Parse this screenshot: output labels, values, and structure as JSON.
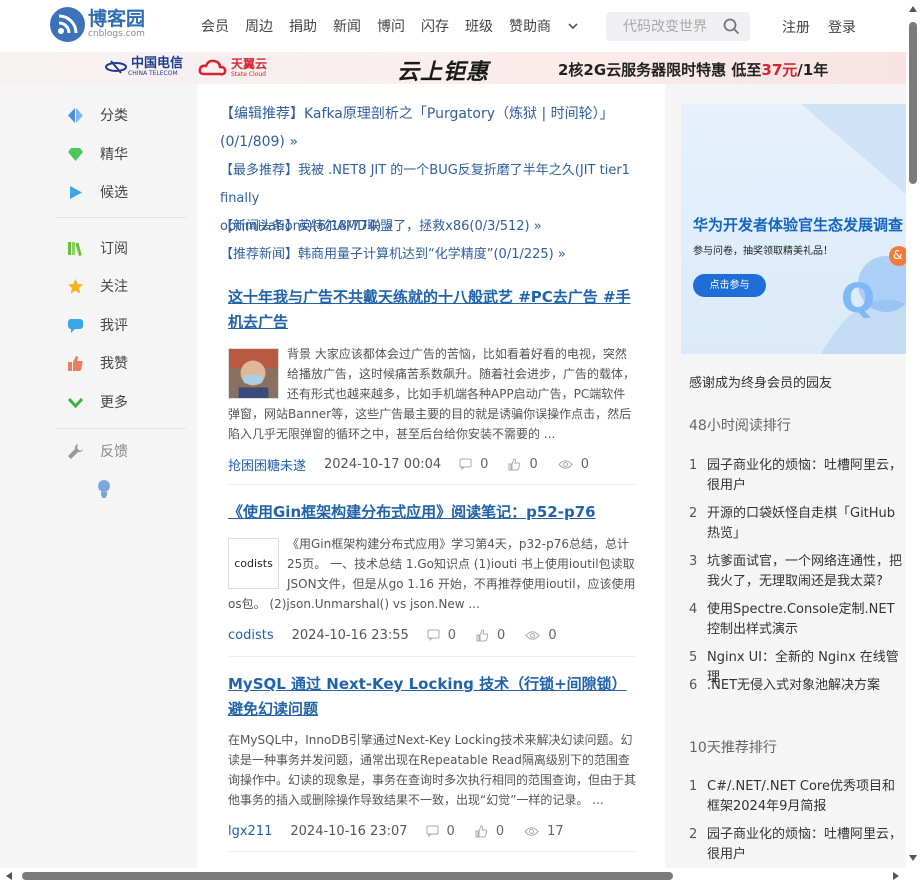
{
  "header": {
    "logo_name": "博客园",
    "logo_domain": "cnblogs.com",
    "nav": [
      "会员",
      "周边",
      "捐助",
      "新闻",
      "博问",
      "闪存",
      "班级",
      "赞助商"
    ],
    "search_placeholder": "代码改变世界",
    "register": "注册",
    "login": "登录"
  },
  "banner": {
    "tel_cn": "中国电信",
    "tel_en": "CHINA TELECOM",
    "tianyi_cn": "天翼云",
    "tianyi_en": "State Cloud",
    "headline": "云上钜惠",
    "promo_a": "2核2G云服务器限时特惠   低至",
    "promo_price": "37元",
    "promo_b": "/1年"
  },
  "sidebar": {
    "items": [
      {
        "label": "分类",
        "icon": "category-icon"
      },
      {
        "label": "精华",
        "icon": "gem-icon"
      },
      {
        "label": "候选",
        "icon": "play-icon"
      },
      {
        "label": "订阅",
        "icon": "books-icon"
      },
      {
        "label": "关注",
        "icon": "star-icon"
      },
      {
        "label": "我评",
        "icon": "comment-icon"
      },
      {
        "label": "我赞",
        "icon": "thumb-up-icon"
      },
      {
        "label": "更多",
        "icon": "chevron-down-icon"
      },
      {
        "label": "反馈",
        "icon": "wrench-icon"
      }
    ]
  },
  "recommend": [
    {
      "tag": "【编辑推荐】",
      "text": "Kafka原理剖析之「Purgatory（炼狱 | 时间轮）」",
      "text2": "(0/1/809) »"
    },
    {
      "tag": "【最多推荐】",
      "text": "我被 .NET8 JIT 的一个BUG反复折磨了半年之久(JIT tier1 finally",
      "text2": "optimizations)(6/18/774) »"
    },
    {
      "tag": "【新闻头条】",
      "text": "英特尔AMD联盟了，拯救x86(0/3/512) »"
    },
    {
      "tag": "【推荐新闻】",
      "text": "韩商用量子计算机达到“化学精度”(0/1/225) »"
    }
  ],
  "posts": [
    {
      "title": "这十年我与广告不共戴天练就的十八般武艺 #PC去广告 #手机去广告",
      "summary": "背景 大家应该都体会过广告的苦恼，比如看着好看的电视，突然给播放广告，这时候痛苦系数飙升。随着社会进步，广告的载体，还有形式也越来越多，比如手机端各种APP启动广告，PC端软件弹窗，网站Banner等，这些广告最主要的目的就是诱骗你误操作点击，然后陷入几乎无限弹窗的循环之中，甚至后台给你安装不需要的 ...",
      "author": "抢困困糖未遂",
      "date": "2024-10-17 00:04",
      "comments": "0",
      "likes": "0",
      "views": "0",
      "avatar_text": ""
    },
    {
      "title": "《使用Gin框架构建分布式应用》阅读笔记：p52-p76",
      "summary": "《用Gin框架构建分布式应用》学习第4天，p32-p76总结，总计25页。 一、技术总结 1.Go知识点 (1)iouti 书上使用ioutil包读取JSON文件，但是从go 1.16 开始，不再推荐使用ioutil，应该使用os包。 (2)json.Unmarshal() vs json.New ...",
      "author": "codists",
      "date": "2024-10-16 23:55",
      "comments": "0",
      "likes": "0",
      "views": "0",
      "avatar_text": "codists"
    },
    {
      "title": "MySQL 通过 Next-Key Locking 技术（行锁+间隙锁）避免幻读问题",
      "summary": "在MySQL中，InnoDB引擎通过Next-Key Locking技术来解决幻读问题。幻读是一种事务并发问题，通常出现在Repeatable Read隔离级别下的范围查询操作中。幻读的现象是，事务在查询时多次执行相同的范围查询，但由于其他事务的插入或删除操作导致结果不一致，出现“幻觉”一样的记录。 ...",
      "author": "lgx211",
      "date": "2024-10-16 23:07",
      "comments": "0",
      "likes": "0",
      "views": "17"
    }
  ],
  "right": {
    "ad_title": "华为开发者体验官生态发展调查",
    "ad_sub": "参与问卷，抽奖领取精美礼品！",
    "ad_button": "点击参与",
    "ad_badge": "&",
    "thanks": "感谢成为终身会员的园友",
    "hot48_title": "48小时阅读排行",
    "hot48": [
      {
        "n": "1",
        "t": "园子商业化的烦恼：吐槽阿里云，很用户"
      },
      {
        "n": "2",
        "t": "开源的口袋妖怪自走棋「GitHub 热览」"
      },
      {
        "n": "3",
        "t": "坑爹面试官，一个网络连通性，把我火了，无理取闹还是我太菜?"
      },
      {
        "n": "4",
        "t": "使用Spectre.Console定制.NET控制出样式演示"
      },
      {
        "n": "5",
        "t": "Nginx UI：全新的 Nginx 在线管理"
      },
      {
        "n": "6",
        "t": ".NET无侵入式对象池解决方案"
      }
    ],
    "rec10_title": "10天推荐排行",
    "rec10": [
      {
        "n": "1",
        "t": "C#/.NET/.NET Core优秀项目和框架2024年9月简报"
      },
      {
        "n": "2",
        "t": "园子商业化的烦恼：吐槽阿里云，很用户"
      }
    ]
  }
}
